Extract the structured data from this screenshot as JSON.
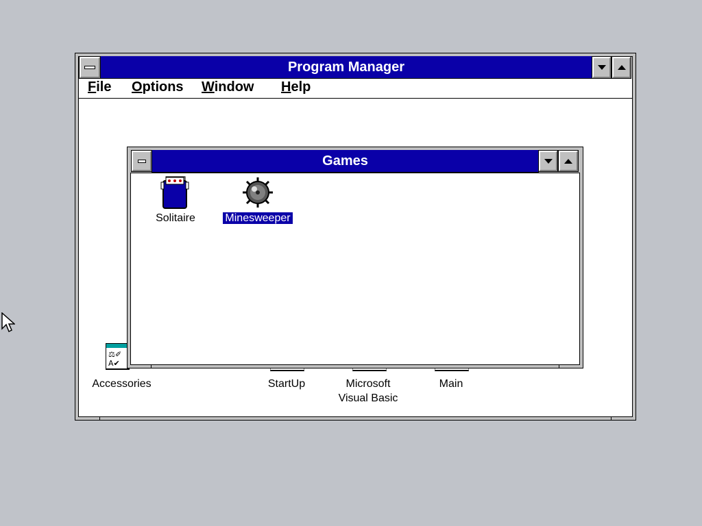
{
  "program_manager": {
    "title": "Program Manager",
    "menu": [
      {
        "pre": "",
        "key": "F",
        "rest": "ile"
      },
      {
        "pre": "",
        "key": "O",
        "rest": "ptions"
      },
      {
        "pre": "",
        "key": "W",
        "rest": "indow"
      },
      {
        "pre": "",
        "key": "H",
        "rest": "elp"
      }
    ],
    "groups": {
      "accessories": "Accessories",
      "startup": "StartUp",
      "visual_basic_line1": "Microsoft",
      "visual_basic_line2": "Visual Basic",
      "main": "Main"
    }
  },
  "games_window": {
    "title": "Games",
    "icons": {
      "solitaire": "Solitaire",
      "minesweeper": "Minesweeper"
    }
  },
  "colors": {
    "title_active": "#0a00a8",
    "desktop": "#c0c3c9",
    "selection": "#0a00a8"
  }
}
